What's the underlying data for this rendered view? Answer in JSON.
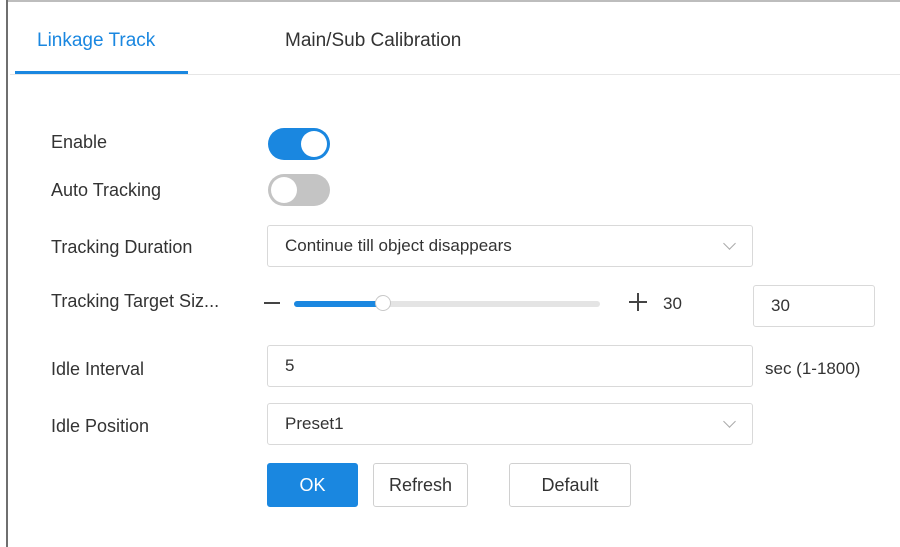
{
  "tabs": [
    {
      "label": "Linkage Track",
      "active": true
    },
    {
      "label": "Main/Sub Calibration",
      "active": false
    }
  ],
  "form": {
    "enable": {
      "label": "Enable",
      "on": true
    },
    "auto_tracking": {
      "label": "Auto Tracking",
      "on": false
    },
    "tracking_duration": {
      "label": "Tracking Duration",
      "value": "Continue till object disappears"
    },
    "tracking_target_size": {
      "label": "Tracking Target Siz...",
      "value": "30",
      "input_value": "30",
      "fraction": 0.29
    },
    "idle_interval": {
      "label": "Idle Interval",
      "value": "5",
      "unit": "sec (1-1800)"
    },
    "idle_position": {
      "label": "Idle Position",
      "value": "Preset1"
    }
  },
  "buttons": {
    "ok": "OK",
    "refresh": "Refresh",
    "default": "Default"
  },
  "colors": {
    "accent": "#1a87e0",
    "toggle_off": "#c4c4c4"
  }
}
